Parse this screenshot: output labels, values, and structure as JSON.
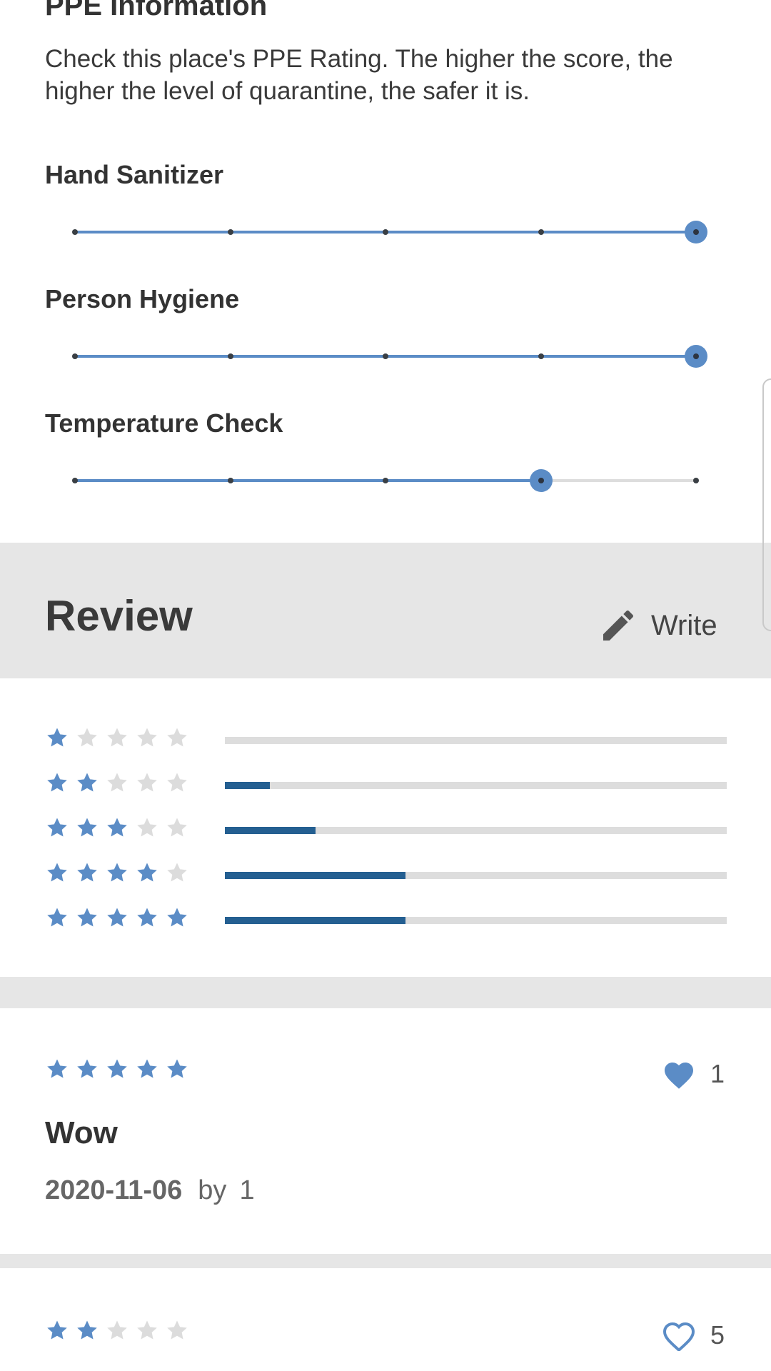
{
  "ppe": {
    "heading": "PPE Information",
    "description": "Check this place's PPE Rating. The higher the score, the higher the level of quarantine, the safer it is.",
    "ratings": [
      {
        "label": "Hand Sanitizer",
        "value": 5,
        "max": 5
      },
      {
        "label": "Person Hygiene",
        "value": 5,
        "max": 5
      },
      {
        "label": "Temperature Check",
        "value": 4,
        "max": 5
      }
    ]
  },
  "review": {
    "title": "Review",
    "write_label": "Write",
    "write_icon": "pencil-icon",
    "distribution": [
      {
        "stars": 1,
        "fraction": 0.0
      },
      {
        "stars": 2,
        "fraction": 0.09
      },
      {
        "stars": 3,
        "fraction": 0.18
      },
      {
        "stars": 4,
        "fraction": 0.36
      },
      {
        "stars": 5,
        "fraction": 0.36
      }
    ],
    "items": [
      {
        "stars": 5,
        "likes": "1",
        "liked": true,
        "title": "Wow",
        "date": "2020-11-06",
        "by_label": "by",
        "author": "1"
      },
      {
        "stars": 2,
        "likes": "5",
        "liked": false,
        "title": "",
        "date": "",
        "by_label": "",
        "author": ""
      }
    ]
  },
  "colors": {
    "accent": "#5b8cc6",
    "bar_fill": "#245f91",
    "star_empty": "#dcdcdc",
    "background": "#e6e6e6"
  }
}
